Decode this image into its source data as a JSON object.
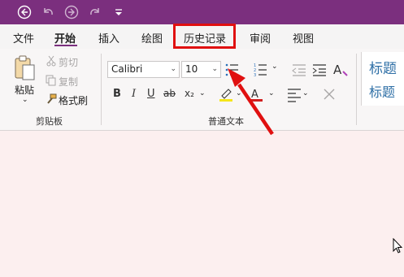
{
  "tabs": [
    "文件",
    "开始",
    "插入",
    "绘图",
    "历史记录",
    "审阅",
    "视图"
  ],
  "clipboard": {
    "paste": "粘贴",
    "cut": "剪切",
    "copy": "复制",
    "format_painter": "格式刷",
    "group": "剪贴板"
  },
  "basic_text": {
    "font": "Calibri",
    "size": "10",
    "group": "普通文本",
    "bold": "B",
    "italic": "I",
    "underline": "U",
    "strike": "ab",
    "subscript": "x₂"
  },
  "styles": {
    "heading1": "标题",
    "heading2": "标题"
  },
  "colors": {
    "accent": "#7b2f7e",
    "highlight": "#e01010",
    "style_text": "#2e6fa6"
  }
}
